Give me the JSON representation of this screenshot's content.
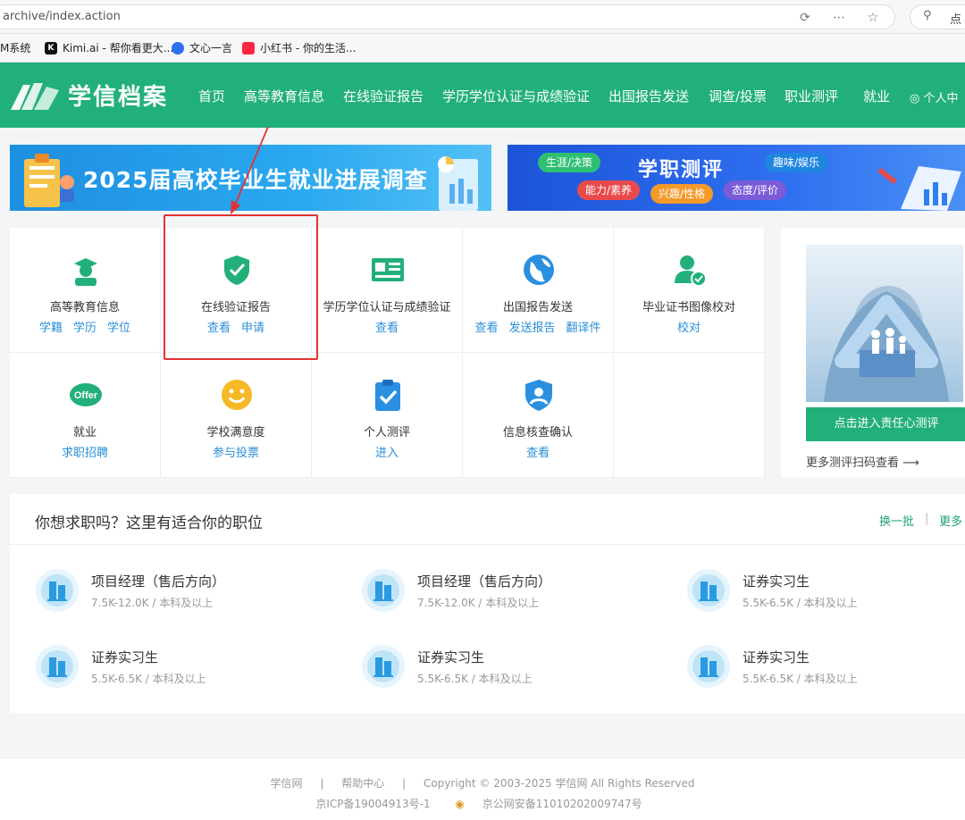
{
  "browser": {
    "url": "archive/index.action",
    "search_text": "点"
  },
  "bookmarks": [
    {
      "label": "M系统",
      "color": "#ffffff"
    },
    {
      "label": "Kimi.ai - 帮你看更大...",
      "color": "#111111"
    },
    {
      "label": "文心一言",
      "color": "#2f6ff0"
    },
    {
      "label": "小红书 - 你的生活...",
      "color": "#ff2442"
    }
  ],
  "nav": {
    "logo_text": "学信档案",
    "items": [
      "首页",
      "高等教育信息",
      "在线验证报告",
      "学历学位认证与成绩验证",
      "出国报告发送",
      "调查/投票",
      "职业测评",
      "就业",
      "个人中"
    ]
  },
  "banners": {
    "left_title": "2025届高校毕业生就业进展调查",
    "right_title": "学职测评",
    "right_pills": [
      "生涯/决策",
      "趣味/娱乐",
      "能力/素养",
      "兴趣/性格",
      "态度/评价"
    ]
  },
  "services": [
    {
      "title": "高等教育信息",
      "links": [
        "学籍",
        "学历",
        "学位"
      ],
      "icon": "graduate-icon"
    },
    {
      "title": "在线验证报告",
      "links": [
        "查看",
        "申请"
      ],
      "icon": "shield-check-icon"
    },
    {
      "title": "学历学位认证与成绩验证",
      "links": [
        "查看"
      ],
      "icon": "certificate-card-icon"
    },
    {
      "title": "出国报告发送",
      "links": [
        "查看",
        "发送报告",
        "翻译件"
      ],
      "icon": "globe-icon"
    },
    {
      "title": "毕业证书图像校对",
      "links": [
        "校对"
      ],
      "icon": "user-check-icon"
    },
    {
      "title": "就业",
      "links": [
        "求职招聘"
      ],
      "icon": "offer-icon"
    },
    {
      "title": "学校满意度",
      "links": [
        "参与投票"
      ],
      "icon": "smile-icon"
    },
    {
      "title": "个人测评",
      "links": [
        "进入"
      ],
      "icon": "clipboard-check-icon"
    },
    {
      "title": "信息核查确认",
      "links": [
        "查看"
      ],
      "icon": "user-shield-icon"
    }
  ],
  "side_card": {
    "button": "点击进入责任心测评",
    "more": "更多测评扫码查看 ⟶"
  },
  "jobs": {
    "title": "你想求职吗？这里有适合你的职位",
    "refresh": "换一批",
    "more": "更多",
    "items": [
      {
        "title": "项目经理（售后方向）",
        "meta": "7.5K-12.0K / 本科及以上"
      },
      {
        "title": "项目经理（售后方向）",
        "meta": "7.5K-12.0K / 本科及以上"
      },
      {
        "title": "证券实习生",
        "meta": "5.5K-6.5K / 本科及以上"
      },
      {
        "title": "证券实习生",
        "meta": "5.5K-6.5K / 本科及以上"
      },
      {
        "title": "证券实习生",
        "meta": "5.5K-6.5K / 本科及以上"
      },
      {
        "title": "证券实习生",
        "meta": "5.5K-6.5K / 本科及以上"
      }
    ]
  },
  "footer": {
    "links": [
      "学信网",
      "|",
      "帮助中心",
      "|",
      "Copyright © 2003-2025 学信网 All Rights Reserved"
    ],
    "icp": "京ICP备19004913号-1",
    "police": "京公网安备11010202009747号"
  },
  "colors": {
    "brand_green": "#22b07a",
    "link_blue": "#2a8fd6",
    "highlight_red": "#e23333"
  }
}
